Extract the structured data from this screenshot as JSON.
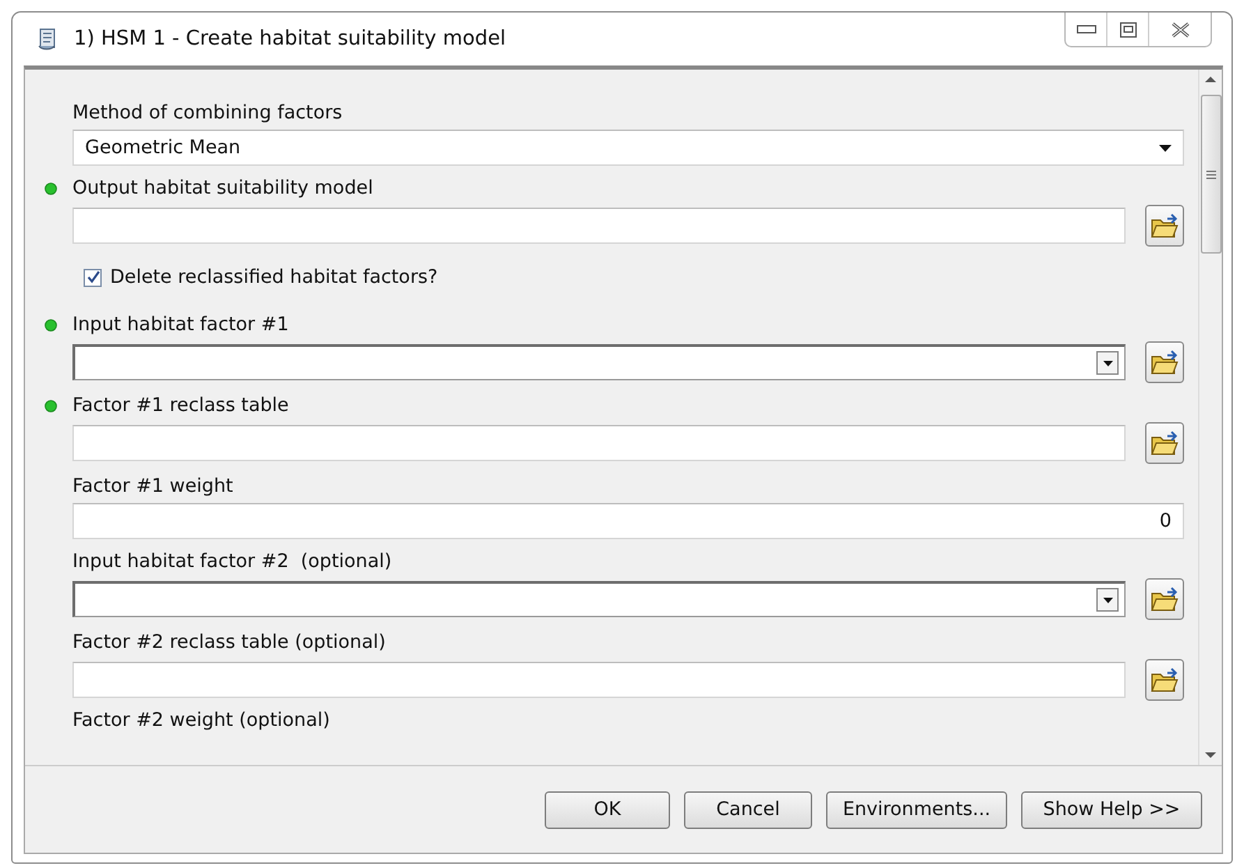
{
  "window": {
    "title": "1) HSM 1 - Create habitat suitability model"
  },
  "parameters": [
    {
      "kind": "choice",
      "label": "Method of combining factors",
      "required": false,
      "value": "Geometric Mean",
      "browse": false
    },
    {
      "kind": "text",
      "label": "Output habitat suitability model",
      "required": true,
      "browse": true
    },
    {
      "kind": "checkbox",
      "label": "Delete reclassified habitat factors?",
      "checked": true
    },
    {
      "kind": "combo",
      "label": "Input habitat factor #1",
      "required": true,
      "browse": true
    },
    {
      "kind": "text",
      "label": "Factor #1 reclass table",
      "required": true,
      "browse": true
    },
    {
      "kind": "number",
      "label": "Factor #1 weight",
      "required": false,
      "value": "0",
      "browse": false
    },
    {
      "kind": "combo",
      "label": "Input habitat factor #2  (optional)",
      "required": false,
      "browse": true
    },
    {
      "kind": "text",
      "label": "Factor #2 reclass table (optional)",
      "required": false,
      "browse": true
    },
    {
      "kind": "partial",
      "label": "Factor #2 weight (optional)"
    }
  ],
  "buttons": [
    "OK",
    "Cancel",
    "Environments...",
    "Show Help >>"
  ]
}
